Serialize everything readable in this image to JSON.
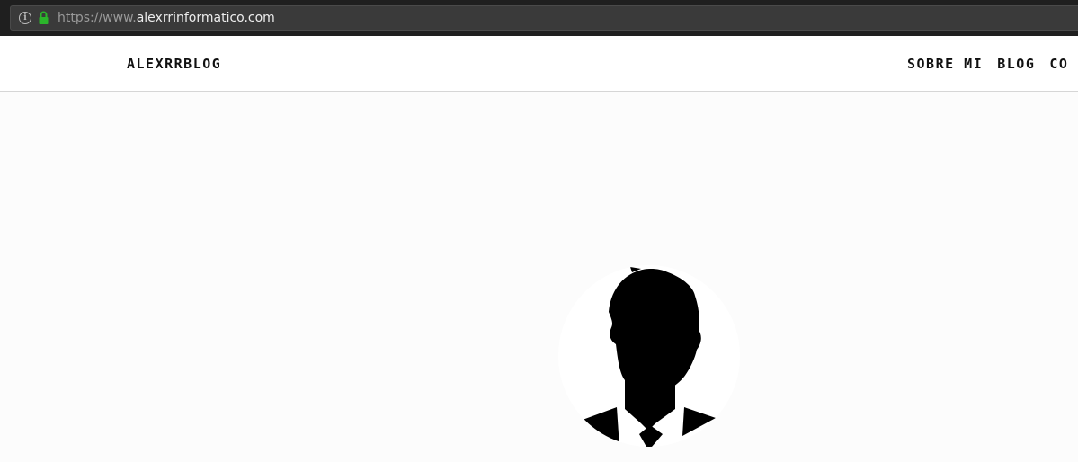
{
  "browser": {
    "url_prefix": "https://www.",
    "url_domain": "alexrrinformatico.com",
    "info_icon": "info-icon",
    "lock_icon": "lock-icon",
    "lock_color": "#2bb52b"
  },
  "header": {
    "brand": "ALEXRRBLOG",
    "nav": [
      {
        "label": "SOBRE MI"
      },
      {
        "label": "BLOG"
      },
      {
        "label": "CO"
      }
    ]
  },
  "hero": {
    "avatar_icon": "person-silhouette-icon"
  }
}
